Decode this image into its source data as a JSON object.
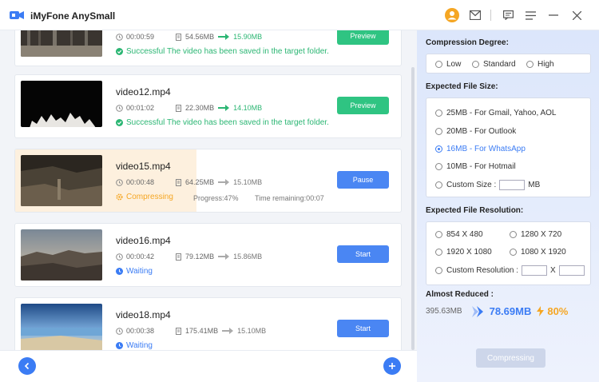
{
  "app": {
    "title": "iMyFone AnySmall"
  },
  "colors": {
    "accent": "#3b7cf4",
    "success": "#2bb673",
    "warning": "#f5a623"
  },
  "videos": [
    {
      "name": "",
      "duration": "00:00:59",
      "size_old": "54.56MB",
      "size_new": "15.90MB",
      "status": "Successful The video has been saved in the target folder.",
      "state": "success",
      "button": "Preview"
    },
    {
      "name": "video12.mp4",
      "duration": "00:01:02",
      "size_old": "22.30MB",
      "size_new": "14.10MB",
      "status": "Successful The video has been saved in the target folder.",
      "state": "success",
      "button": "Preview"
    },
    {
      "name": "video15.mp4",
      "duration": "00:00:48",
      "size_old": "64.25MB",
      "size_new": "15.10MB",
      "status": "Compressing",
      "state": "compressing",
      "progress_label": "Progress:47%",
      "progress": 0.47,
      "time_remaining": "Time remaining:00:07",
      "button": "Pause"
    },
    {
      "name": "video16.mp4",
      "duration": "00:00:42",
      "size_old": "79.12MB",
      "size_new": "15.86MB",
      "status": "Waiting",
      "state": "waiting",
      "button": "Start"
    },
    {
      "name": "video18.mp4",
      "duration": "00:00:38",
      "size_old": "175.41MB",
      "size_new": "15.10MB",
      "status": "Waiting",
      "state": "waiting",
      "button": "Start"
    }
  ],
  "panel": {
    "degree_title": "Compression Degree:",
    "degree_options": [
      "Low",
      "Standard",
      "High"
    ],
    "size_title": "Expected File Size:",
    "size_options": [
      "25MB - For Gmail, Yahoo, AOL",
      "20MB - For Outlook",
      "16MB - For WhatsApp",
      "10MB - For Hotmail"
    ],
    "custom_size_label": "Custom Size :",
    "custom_size_unit": "MB",
    "resolution_title": "Expected File Resolution:",
    "resolution_options": [
      "854 X 480",
      "1280 X 720",
      "1920 X 1080",
      "1080 X 1920"
    ],
    "custom_resolution_label": "Custom Resolution :",
    "custom_resolution_sep": "X",
    "reduced_title": "Almost Reduced :",
    "reduced_old": "395.63MB",
    "reduced_new": "78.69MB",
    "reduced_pct": "80%",
    "compress_button": "Compressing"
  }
}
